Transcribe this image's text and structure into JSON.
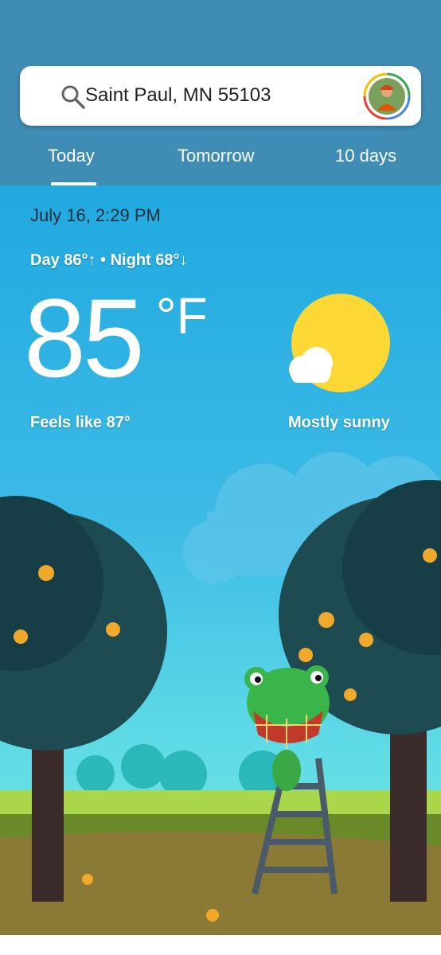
{
  "search": {
    "query": "Saint Paul, MN 55103",
    "icon": "search-icon",
    "avatar": "account-avatar"
  },
  "tabs": [
    {
      "label": "Today",
      "selected": true
    },
    {
      "label": "Tomorrow",
      "selected": false
    },
    {
      "label": "10 days",
      "selected": false
    }
  ],
  "weather": {
    "datetime": "July 16, 2:29 PM",
    "day_night": "Day 86°↑ • Night 68°↓",
    "temperature": "85",
    "unit": "°F",
    "feels_like": "Feels like 87°",
    "condition": "Mostly sunny"
  },
  "colors": {
    "header": "#3f8db5",
    "sky": "#27a9dc",
    "sun": "#fdd835"
  }
}
